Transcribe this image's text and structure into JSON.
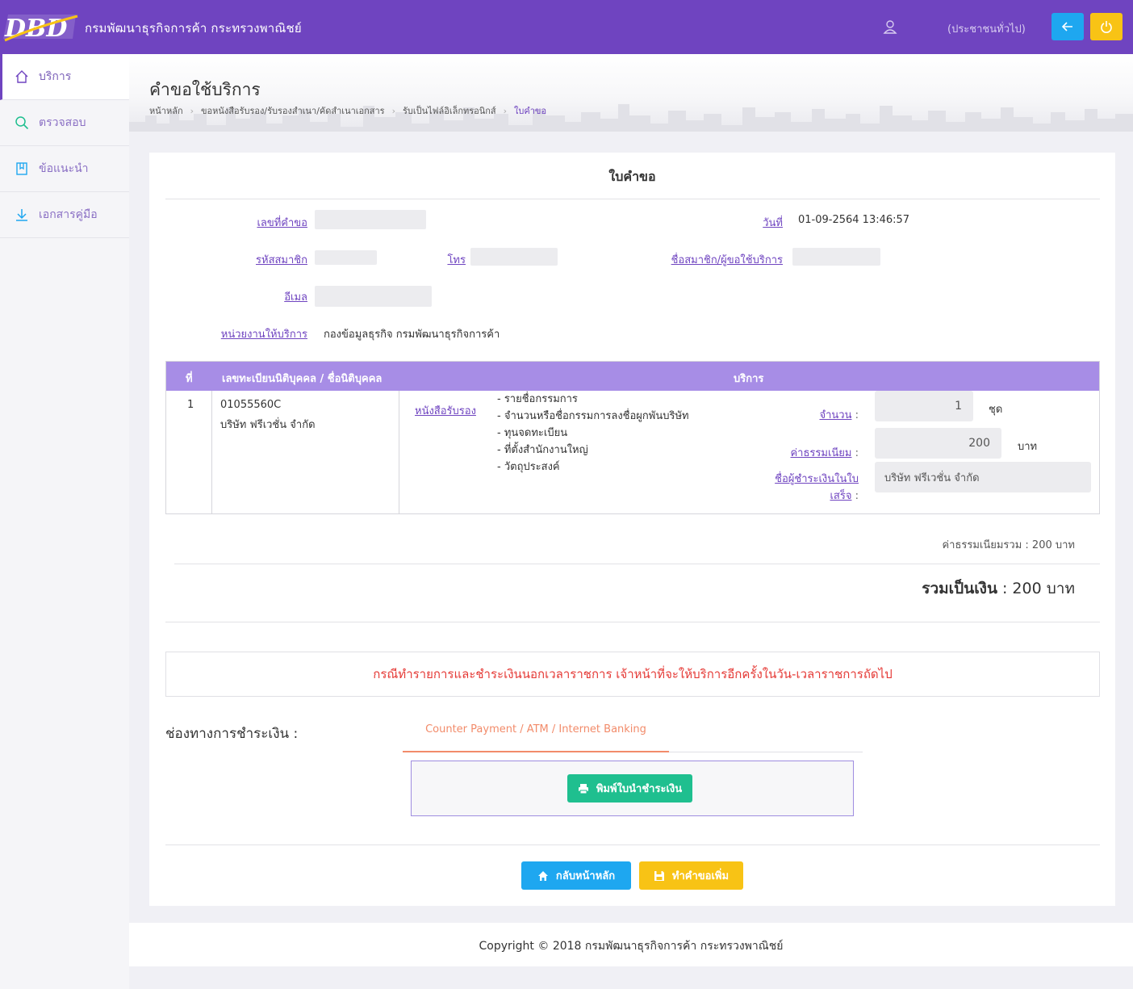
{
  "header": {
    "brand": "กรมพัฒนาธุรกิจการค้า กระทรวงพาณิชย์",
    "user_label": "(ประชาชนทั่วไป)"
  },
  "sidebar": {
    "items": [
      {
        "label": "บริการ"
      },
      {
        "label": "ตรวจสอบ"
      },
      {
        "label": "ข้อแนะนำ"
      },
      {
        "label": "เอกสารคู่มือ"
      }
    ]
  },
  "page": {
    "title": "คำขอใช้บริการ",
    "breadcrumb": [
      "หน้าหลัก",
      "ขอหนังสือรับรอง/รับรองสำเนา/คัดสำเนาเอกสาร",
      "รับเป็นไฟล์อิเล็กทรอนิกส์",
      "ใบคำขอ"
    ]
  },
  "form": {
    "title": "ใบคำขอ",
    "request_no_label": "เลขที่คำขอ",
    "date_label": "วันที่",
    "date_value": "01-09-2564 13:46:57",
    "member_id_label": "รหัสสมาชิก",
    "phone_label": "โทร",
    "member_name_label": "ชื่อสมาชิก/ผู้ขอใช้บริการ",
    "email_label": "อีเมล",
    "unit_label": "หน่วยงานให้บริการ",
    "unit_value": "กองข้อมูลธุรกิจ กรมพัฒนาธุรกิจการค้า"
  },
  "table": {
    "headers": [
      "ที่",
      "เลขทะเบียนนิติบุคคล / ชื่อนิติบุคคล",
      "บริการ"
    ],
    "row": {
      "no": "1",
      "reg_no": "01055560C",
      "company": "บริษัท ฟรีเวชั่น จำกัด",
      "service_link": "หนังสือรับรอง",
      "service_items": [
        "- รายชื่อกรรมการ",
        "- จำนวนหรือชื่อกรรมการลงชื่อผูกพันบริษัท",
        "- ทุนจดทะเบียน",
        "- ที่ตั้งสำนักงานใหญ่",
        "- วัตถุประสงค์"
      ],
      "qty_label": "จำนวน",
      "qty_value": "1",
      "qty_unit": "ชุด",
      "fee_label": "ค่าธรรมเนียม",
      "fee_value": "200",
      "fee_unit": "บาท",
      "payer_label_1": "ชื่อผู้ชำระเงินในใบ",
      "payer_label_2": "เสร็จ",
      "payer_value": "บริษัท ฟรีเวชั่น จำกัด",
      "colon": ":"
    }
  },
  "totals": {
    "fee_total": "ค่าธรรมเนียมรวม : 200 บาท",
    "grand_label": "รวมเป็นเงิน",
    "grand_rest": " : 200 บาท"
  },
  "notice": "กรณีทำรายการและชำระเงินนอกเวลาราชการ เจ้าหน้าที่จะให้บริการอีกครั้งในวัน-เวลาราชการถัดไป",
  "payment": {
    "label": "ช่องทางการชำระเงิน :",
    "tab": "Counter Payment / ATM / Internet Banking",
    "print_button": "พิมพ์ใบนำชำระเงิน"
  },
  "actions": {
    "home": "กลับหน้าหลัก",
    "more": "ทำคำขอเพิ่ม"
  },
  "footer": "Copyright © 2018 กรมพัฒนาธุรกิจการค้า กระทรวงพาณิชย์",
  "colors": {
    "brand_purple": "#6f44c0",
    "table_header": "#a78de6",
    "blue": "#1ea7f0",
    "yellow": "#f8c315",
    "green": "#1fbf8f",
    "notice_red": "#e53935"
  }
}
